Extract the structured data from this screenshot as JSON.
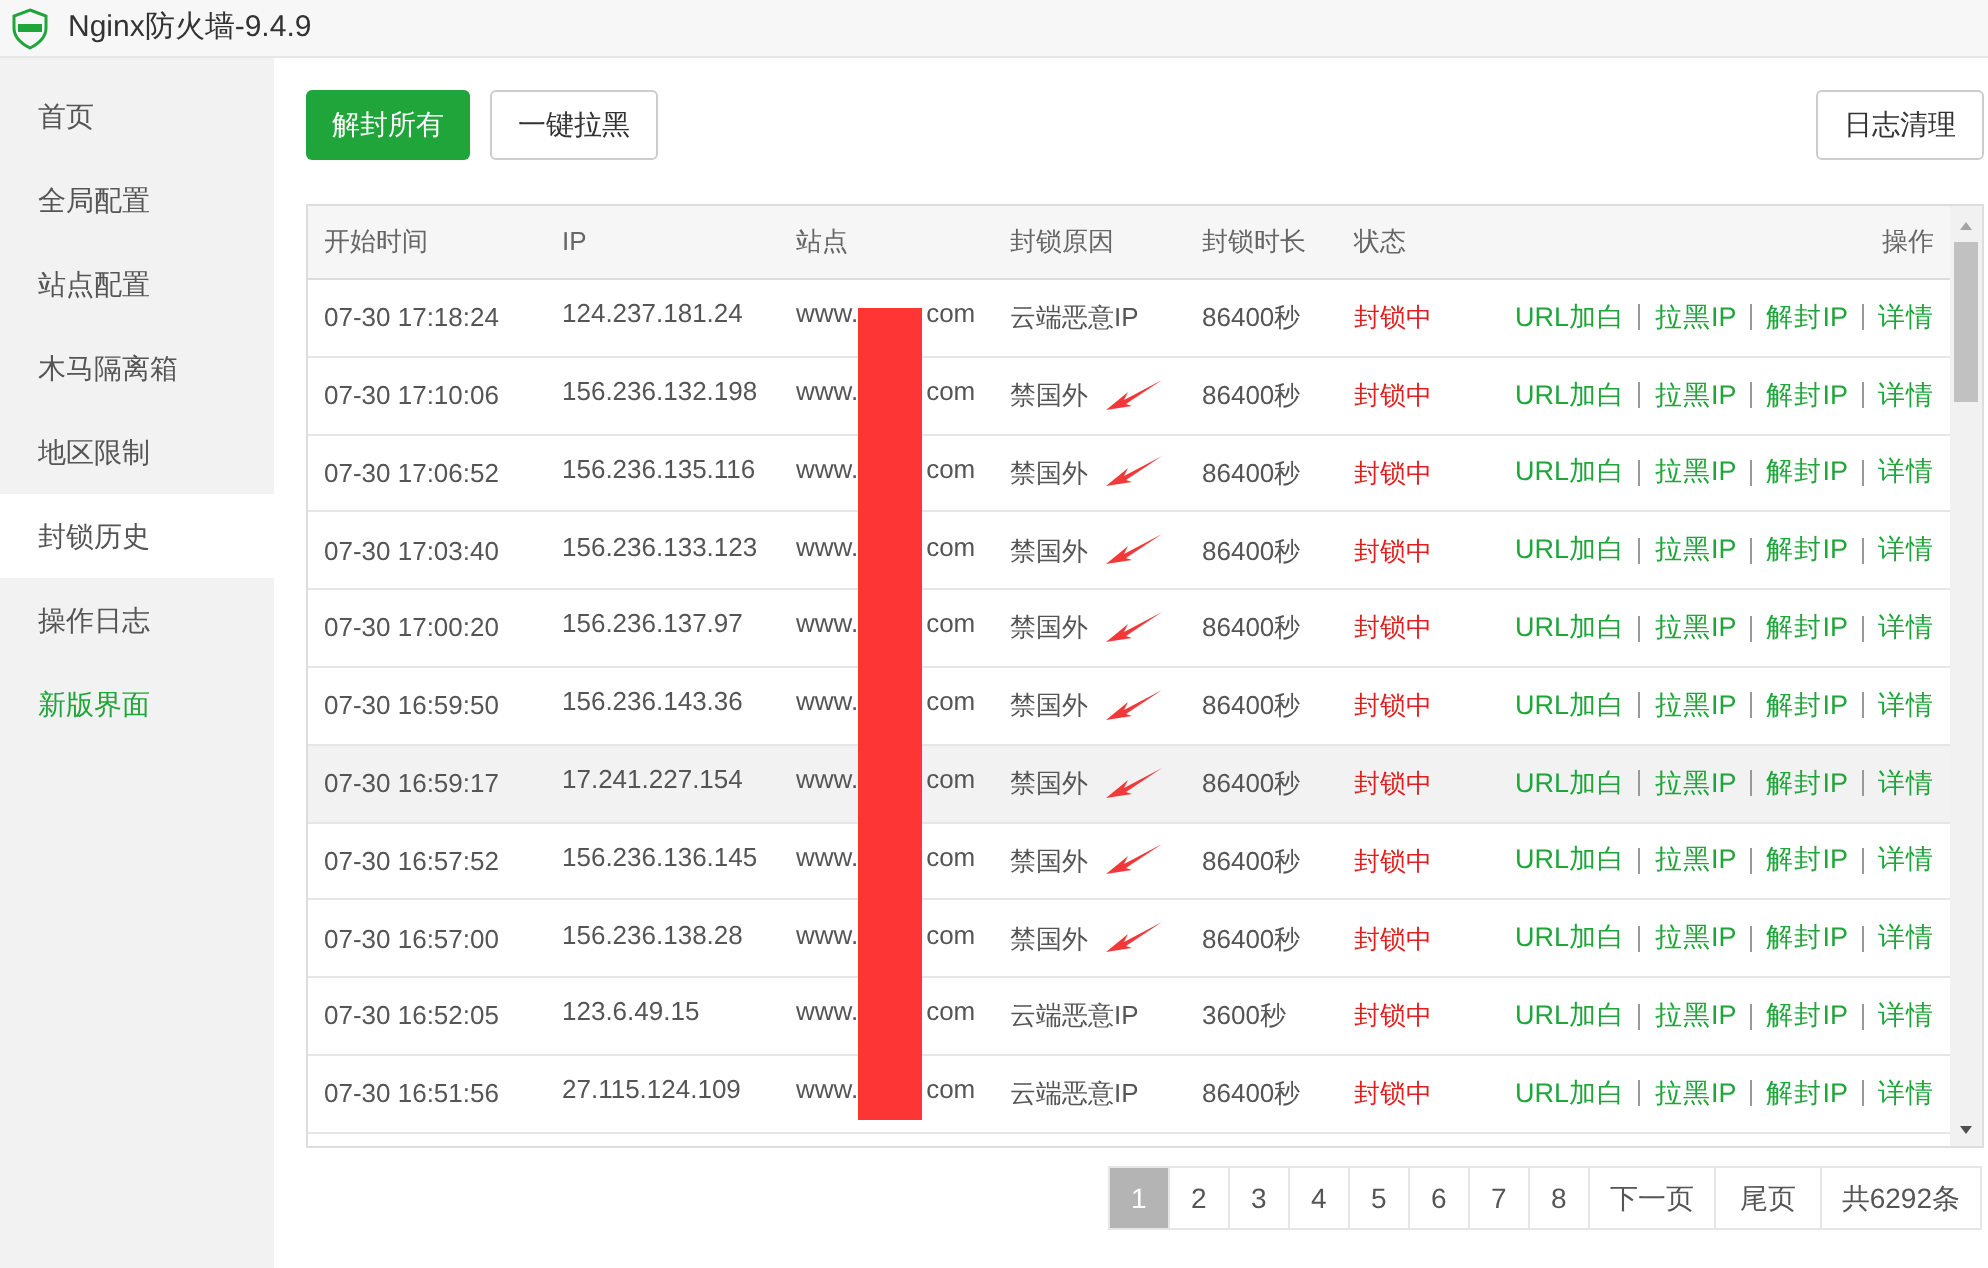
{
  "window": {
    "title": "Nginx防火墙-9.4.9"
  },
  "sidebar": {
    "items": [
      {
        "label": "首页",
        "selected": false,
        "kind": "normal"
      },
      {
        "label": "全局配置",
        "selected": false,
        "kind": "normal"
      },
      {
        "label": "站点配置",
        "selected": false,
        "kind": "normal"
      },
      {
        "label": "木马隔离箱",
        "selected": false,
        "kind": "normal"
      },
      {
        "label": "地区限制",
        "selected": false,
        "kind": "normal"
      },
      {
        "label": "封锁历史",
        "selected": true,
        "kind": "normal"
      },
      {
        "label": "操作日志",
        "selected": false,
        "kind": "normal"
      },
      {
        "label": "新版界面",
        "selected": false,
        "kind": "highlight"
      }
    ]
  },
  "toolbar": {
    "buttons": [
      {
        "label": "解封所有",
        "kind": "primary"
      },
      {
        "label": "一键拉黑",
        "kind": "default"
      }
    ],
    "clear_button": "日志清理"
  },
  "table": {
    "columns": [
      "开始时间",
      "IP",
      "站点",
      "封锁原因",
      "封锁时长",
      "状态",
      "操作"
    ],
    "rows": [
      {
        "time": "07-30 17:18:24",
        "ip": "124.237.181.24",
        "site_start": "www.",
        "site_end": "com",
        "reason": "云端恶意IP",
        "duration": "86400秒",
        "status": "封锁中",
        "arrow": false,
        "selected": false,
        "actions": [
          "URL加白",
          "拉黑IP",
          "解封IP",
          "详情"
        ]
      },
      {
        "time": "07-30 17:10:06",
        "ip": "156.236.132.198",
        "site_start": "www.",
        "site_end": "com",
        "reason": "禁国外",
        "duration": "86400秒",
        "status": "封锁中",
        "arrow": true,
        "selected": false,
        "actions": [
          "URL加白",
          "拉黑IP",
          "解封IP",
          "详情"
        ]
      },
      {
        "time": "07-30 17:06:52",
        "ip": "156.236.135.116",
        "site_start": "www.",
        "site_end": "com",
        "reason": "禁国外",
        "duration": "86400秒",
        "status": "封锁中",
        "arrow": true,
        "selected": false,
        "actions": [
          "URL加白",
          "拉黑IP",
          "解封IP",
          "详情"
        ]
      },
      {
        "time": "07-30 17:03:40",
        "ip": "156.236.133.123",
        "site_start": "www.",
        "site_end": "com",
        "reason": "禁国外",
        "duration": "86400秒",
        "status": "封锁中",
        "arrow": true,
        "selected": false,
        "actions": [
          "URL加白",
          "拉黑IP",
          "解封IP",
          "详情"
        ]
      },
      {
        "time": "07-30 17:00:20",
        "ip": "156.236.137.97",
        "site_start": "www.",
        "site_end": "com",
        "reason": "禁国外",
        "duration": "86400秒",
        "status": "封锁中",
        "arrow": true,
        "selected": false,
        "actions": [
          "URL加白",
          "拉黑IP",
          "解封IP",
          "详情"
        ]
      },
      {
        "time": "07-30 16:59:50",
        "ip": "156.236.143.36",
        "site_start": "www.",
        "site_end": "com",
        "reason": "禁国外",
        "duration": "86400秒",
        "status": "封锁中",
        "arrow": true,
        "selected": false,
        "actions": [
          "URL加白",
          "拉黑IP",
          "解封IP",
          "详情"
        ]
      },
      {
        "time": "07-30 16:59:17",
        "ip": "17.241.227.154",
        "site_start": "www.",
        "site_end": "com",
        "reason": "禁国外",
        "duration": "86400秒",
        "status": "封锁中",
        "arrow": true,
        "selected": true,
        "actions": [
          "URL加白",
          "拉黑IP",
          "解封IP",
          "详情"
        ]
      },
      {
        "time": "07-30 16:57:52",
        "ip": "156.236.136.145",
        "site_start": "www.",
        "site_end": "com",
        "reason": "禁国外",
        "duration": "86400秒",
        "status": "封锁中",
        "arrow": true,
        "selected": false,
        "actions": [
          "URL加白",
          "拉黑IP",
          "解封IP",
          "详情"
        ]
      },
      {
        "time": "07-30 16:57:00",
        "ip": "156.236.138.28",
        "site_start": "www.",
        "site_end": "com",
        "reason": "禁国外",
        "duration": "86400秒",
        "status": "封锁中",
        "arrow": true,
        "selected": false,
        "actions": [
          "URL加白",
          "拉黑IP",
          "解封IP",
          "详情"
        ]
      },
      {
        "time": "07-30 16:52:05",
        "ip": "123.6.49.15",
        "site_start": "www.",
        "site_end": "com",
        "reason": "云端恶意IP",
        "duration": "3600秒",
        "status": "封锁中",
        "arrow": false,
        "selected": false,
        "actions": [
          "URL加白",
          "拉黑IP",
          "解封IP",
          "详情"
        ]
      },
      {
        "time": "07-30 16:51:56",
        "ip": "27.115.124.109",
        "site_start": "www.",
        "site_end": "com",
        "reason": "云端恶意IP",
        "duration": "86400秒",
        "status": "封锁中",
        "arrow": false,
        "selected": false,
        "actions": [
          "URL加白",
          "拉黑IP",
          "解封IP",
          "详情"
        ]
      }
    ]
  },
  "pagination": {
    "pages": [
      {
        "label": "1",
        "selected": true
      },
      {
        "label": "2",
        "selected": false
      },
      {
        "label": "3",
        "selected": false
      },
      {
        "label": "4",
        "selected": false
      },
      {
        "label": "5",
        "selected": false
      },
      {
        "label": "6",
        "selected": false
      },
      {
        "label": "7",
        "selected": false
      },
      {
        "label": "8",
        "selected": false
      }
    ],
    "next": "下一页",
    "last": "尾页",
    "total": "共6292条"
  }
}
